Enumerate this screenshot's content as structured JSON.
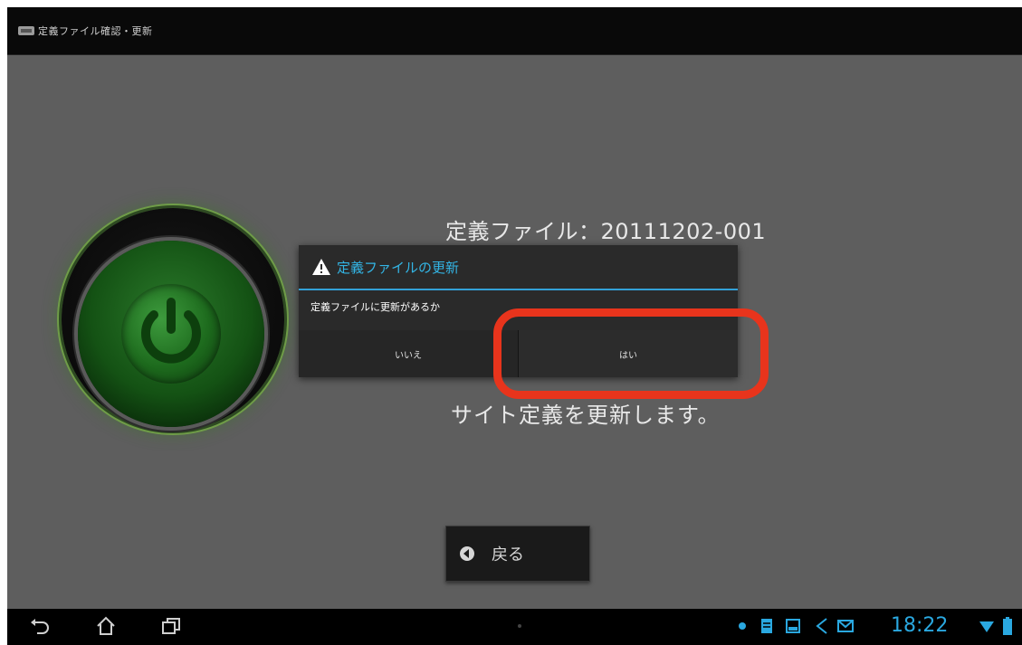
{
  "titlebar": {
    "title": "定義ファイル確認・更新"
  },
  "content": {
    "definition_file": "定義ファイル：20111202-001",
    "site_message": "サイト定義を更新します。"
  },
  "dialog": {
    "title": "定義ファイルの更新",
    "message": "定義ファイルに更新があるか",
    "no_label": "いいえ",
    "yes_label": "はい"
  },
  "back_button": {
    "label": "戻る"
  },
  "statusbar": {
    "time": "18:22",
    "icons": [
      "back-nav-icon",
      "home-nav-icon",
      "recent-apps-icon",
      "notification-dot-icon",
      "document-icon",
      "screenshot-icon",
      "usb-debug-icon",
      "mail-icon",
      "wifi-icon",
      "battery-icon"
    ]
  },
  "colors": {
    "accent": "#33b5e5",
    "highlight": "#e8341c",
    "logo_green": "#2b7a2b"
  }
}
